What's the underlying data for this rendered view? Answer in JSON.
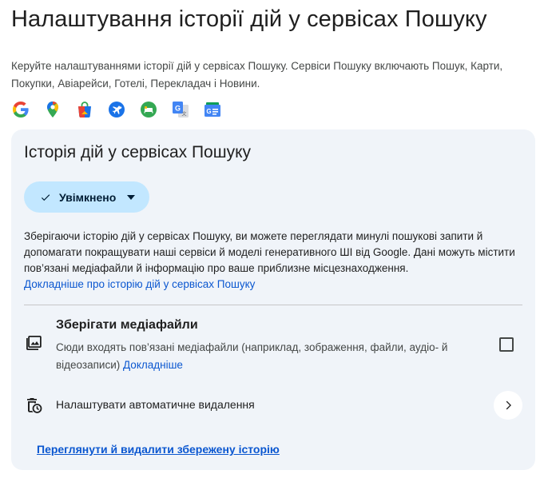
{
  "page": {
    "title": "Налаштування історії дій у сервісах Пошуку",
    "intro": "Керуйте налаштуваннями історії дій у сервісах Пошуку. Сервіси Пошуку включають Пошук, Карти, Покупки, Авіарейси, Готелі, Перекладач і Новини."
  },
  "apps": [
    {
      "icon": "google-g-icon"
    },
    {
      "icon": "maps-pin-icon"
    },
    {
      "icon": "shopping-bag-icon"
    },
    {
      "icon": "flights-icon"
    },
    {
      "icon": "hotels-icon"
    },
    {
      "icon": "translate-icon"
    },
    {
      "icon": "news-icon"
    }
  ],
  "card": {
    "title": "Історія дій у сервісах Пошуку",
    "status_label": "Увімкнено",
    "description": "Зберігаючи історію дій у сервісах Пошуку, ви можете переглядати минулі пошукові запити й допомагати покращувати наші сервіси й моделі генеративного ШІ від Google. Дані можуть містити пов’язані медіафайли й інформацію про ваше приблизне місцезнаходження.",
    "learn_more_link": "Докладніше про історію дій у сервісах Пошуку",
    "media": {
      "title": "Зберігати медіафайли",
      "description": "Сюди входять пов’язані медіафайли (наприклад, зображення, файли, аудіо- й відеозаписи)",
      "learn_more": "Докладніше",
      "checked": false
    },
    "auto_delete_label": "Налаштувати автоматичне видалення",
    "view_history_link": "Переглянути й видалити збережену історію"
  },
  "colors": {
    "chip_bg": "#c2e7ff",
    "card_bg": "#f0f4f9",
    "link": "#0b57d0"
  }
}
